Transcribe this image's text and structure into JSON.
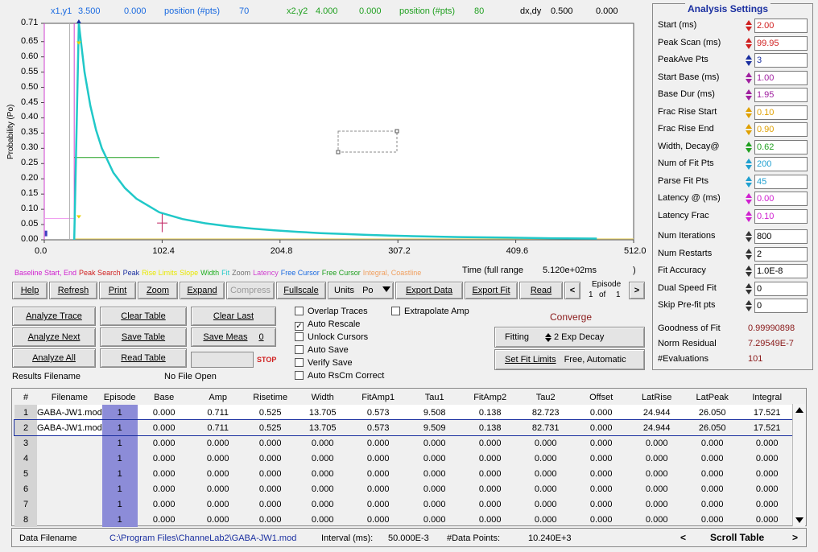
{
  "cursor_readout": {
    "x1y1_label": "x1,y1",
    "x1_val": "3.500",
    "y1_val": "0.000",
    "pos1_label": "position (#pts)",
    "pos1_val": "70",
    "x2y2_label": "x2,y2",
    "x2_val": "4.000",
    "y2_val": "0.000",
    "pos2_label": "position (#pts)",
    "pos2_val": "80",
    "dxdy_label": "dx,dy",
    "dx_val": "0.500",
    "dy_val": "0.000"
  },
  "chart_data": {
    "type": "line",
    "ylabel": "Probability (Po)",
    "xlabel": "Time (full range",
    "full_range": "5.120e+02ms",
    "full_range_close": ")",
    "xlim": [
      0.0,
      512.0
    ],
    "ylim": [
      0.0,
      0.71
    ],
    "x_ticks": [
      "0.0",
      "102.4",
      "204.8",
      "307.2",
      "409.6",
      "512.0"
    ],
    "y_ticks": [
      "0.71",
      "0.65",
      "0.60",
      "0.55",
      "0.50",
      "0.45",
      "0.40",
      "0.35",
      "0.30",
      "0.25",
      "0.20",
      "0.15",
      "0.10",
      "0.05",
      "0.00"
    ],
    "series": [
      {
        "color": "#20c8c8",
        "x": [
          26,
          30,
          35,
          40,
          45,
          50,
          60,
          70,
          80,
          100,
          120,
          140,
          160,
          180,
          200,
          220,
          240,
          260,
          280,
          300,
          320,
          360,
          400,
          440,
          480
        ],
        "y": [
          0.0,
          0.71,
          0.55,
          0.44,
          0.36,
          0.3,
          0.22,
          0.17,
          0.135,
          0.09,
          0.068,
          0.054,
          0.044,
          0.037,
          0.031,
          0.026,
          0.022,
          0.019,
          0.016,
          0.014,
          0.012,
          0.009,
          0.007,
          0.005,
          0.004
        ]
      }
    ]
  },
  "legend": [
    {
      "text": "Baseline Start, End",
      "color": "#d020d0"
    },
    {
      "text": "Peak Search",
      "color": "#d02020"
    },
    {
      "text": "Peak",
      "color": "#1a2fa0"
    },
    {
      "text": "Rise Limits",
      "color": "#e8e800"
    },
    {
      "text": "Slope",
      "color": "#e8e800"
    },
    {
      "text": "Width",
      "color": "#20b020"
    },
    {
      "text": "Fit",
      "color": "#20c8c8"
    },
    {
      "text": "Zoom",
      "color": "#707070"
    },
    {
      "text": "Latency",
      "color": "#d040d0"
    },
    {
      "text": "Free Cursor",
      "color": "#1a6ae0"
    },
    {
      "text": "Free Cursor",
      "color": "#20a020"
    },
    {
      "text": "Integral, Coastline",
      "color": "#f0a060"
    }
  ],
  "toolbar": {
    "help": "Help",
    "refresh": "Refresh",
    "print": "Print",
    "zoom": "Zoom",
    "expand": "Expand",
    "compress": "Compress",
    "fullscale": "Fullscale",
    "units": "Units",
    "units_value": "Po",
    "export_data": "Export Data",
    "export_fit": "Export Fit",
    "read": "Read",
    "prev": "<",
    "next": ">",
    "episode_label": "Episode",
    "episode_num": "1",
    "episode_of": "of",
    "episode_total": "1"
  },
  "actions": {
    "analyze_trace": "Analyze Trace",
    "clear_table": "Clear Table",
    "clear_last": "Clear Last",
    "analyze_next": "Analyze Next",
    "save_table": "Save Table",
    "save_meas": "Save Meas",
    "save_meas_count": "0",
    "analyze_all": "Analyze All",
    "read_table": "Read Table",
    "stop": "STOP",
    "results_filename_label": "Results Filename",
    "results_filename_value": "No File Open"
  },
  "checkboxes": [
    {
      "label": "Overlap Traces",
      "checked": false
    },
    {
      "label": "Auto Rescale",
      "checked": true
    },
    {
      "label": "Unlock Cursors",
      "checked": false
    },
    {
      "label": "Auto Save",
      "checked": false
    },
    {
      "label": "Verify Save",
      "checked": false
    },
    {
      "label": "Auto RsCm Correct",
      "checked": false
    }
  ],
  "extrapolate_amp": {
    "label": "Extrapolate Amp",
    "checked": false
  },
  "fitting": {
    "converge": "Converge",
    "fitting_label": "Fitting",
    "fitting_value": "2 Exp Decay",
    "set_fit_limits": "Set Fit Limits",
    "fit_limits_value": "Free, Automatic"
  },
  "analysis_settings": {
    "title": "Analysis Settings",
    "rows": [
      {
        "label": "Start  (ms)",
        "value": "2.00",
        "color": "#d02020"
      },
      {
        "label": "Peak Scan (ms)",
        "value": "99.95",
        "color": "#d02020"
      },
      {
        "label": "PeakAve Pts",
        "value": "3",
        "color": "#1a2fa0"
      },
      {
        "label": "Start Base (ms)",
        "value": "1.00",
        "color": "#a020a0"
      },
      {
        "label": "Base Dur (ms)",
        "value": "1.95",
        "color": "#a020a0"
      },
      {
        "label": "Frac Rise Start",
        "value": "0.10",
        "color": "#e0a000"
      },
      {
        "label": "Frac Rise End",
        "value": "0.90",
        "color": "#e0a000"
      },
      {
        "label": "Width, Decay@",
        "value": "0.62",
        "color": "#20a020"
      },
      {
        "label": "Num of Fit Pts",
        "value": "200",
        "color": "#20a0d0"
      },
      {
        "label": "Parse Fit Pts",
        "value": "45",
        "color": "#20a0d0"
      },
      {
        "label": "Latency @ (ms)",
        "value": "0.00",
        "color": "#d020d0"
      },
      {
        "label": "Latency Frac",
        "value": "0.10",
        "color": "#d020d0"
      },
      {
        "label": "Num Iterations",
        "value": "800",
        "color": "#000000"
      },
      {
        "label": "Num Restarts",
        "value": "2",
        "color": "#000000"
      },
      {
        "label": "Fit Accuracy",
        "value": "1.0E-8",
        "color": "#000000"
      },
      {
        "label": "Dual Speed Fit",
        "value": "0",
        "color": "#000000"
      },
      {
        "label": "Skip Pre-fit pts",
        "value": "0",
        "color": "#000000"
      }
    ],
    "goodness_label": "Goodness of Fit",
    "goodness_value": "0.99990898",
    "norm_residual_label": "Norm Residual",
    "norm_residual_value": "7.29549E-7",
    "evaluations_label": "#Evaluations",
    "evaluations_value": "101"
  },
  "table": {
    "headers": [
      "#",
      "Filename",
      "Episode",
      "Base",
      "Amp",
      "Risetime",
      "Width",
      "FitAmp1",
      "Tau1",
      "FitAmp2",
      "Tau2",
      "Offset",
      "LatRise",
      "LatPeak",
      "Integral"
    ],
    "rows": [
      [
        "1",
        "GABA-JW1.mod",
        "1",
        "0.000",
        "0.711",
        "0.525",
        "13.705",
        "0.573",
        "9.508",
        "0.138",
        "82.723",
        "0.000",
        "24.944",
        "26.050",
        "17.521"
      ],
      [
        "2",
        "GABA-JW1.mod",
        "1",
        "0.000",
        "0.711",
        "0.525",
        "13.705",
        "0.573",
        "9.509",
        "0.138",
        "82.731",
        "0.000",
        "24.944",
        "26.050",
        "17.521"
      ],
      [
        "3",
        "",
        "1",
        "0.000",
        "0.000",
        "0.000",
        "0.000",
        "0.000",
        "0.000",
        "0.000",
        "0.000",
        "0.000",
        "0.000",
        "0.000",
        "0.000"
      ],
      [
        "4",
        "",
        "1",
        "0.000",
        "0.000",
        "0.000",
        "0.000",
        "0.000",
        "0.000",
        "0.000",
        "0.000",
        "0.000",
        "0.000",
        "0.000",
        "0.000"
      ],
      [
        "5",
        "",
        "1",
        "0.000",
        "0.000",
        "0.000",
        "0.000",
        "0.000",
        "0.000",
        "0.000",
        "0.000",
        "0.000",
        "0.000",
        "0.000",
        "0.000"
      ],
      [
        "6",
        "",
        "1",
        "0.000",
        "0.000",
        "0.000",
        "0.000",
        "0.000",
        "0.000",
        "0.000",
        "0.000",
        "0.000",
        "0.000",
        "0.000",
        "0.000"
      ],
      [
        "7",
        "",
        "1",
        "0.000",
        "0.000",
        "0.000",
        "0.000",
        "0.000",
        "0.000",
        "0.000",
        "0.000",
        "0.000",
        "0.000",
        "0.000",
        "0.000"
      ],
      [
        "8",
        "",
        "1",
        "0.000",
        "0.000",
        "0.000",
        "0.000",
        "0.000",
        "0.000",
        "0.000",
        "0.000",
        "0.000",
        "0.000",
        "0.000",
        "0.000"
      ]
    ]
  },
  "status": {
    "data_filename_label": "Data Filename",
    "data_filename_value": "C:\\Program Files\\ChanneLab2\\GABA-JW1.mod",
    "interval_label": "Interval (ms):",
    "interval_value": "50.000E-3",
    "points_label": "#Data Points:",
    "points_value": "10.240E+3",
    "scroll_prev": "<",
    "scroll_label": "Scroll Table",
    "scroll_next": ">"
  }
}
